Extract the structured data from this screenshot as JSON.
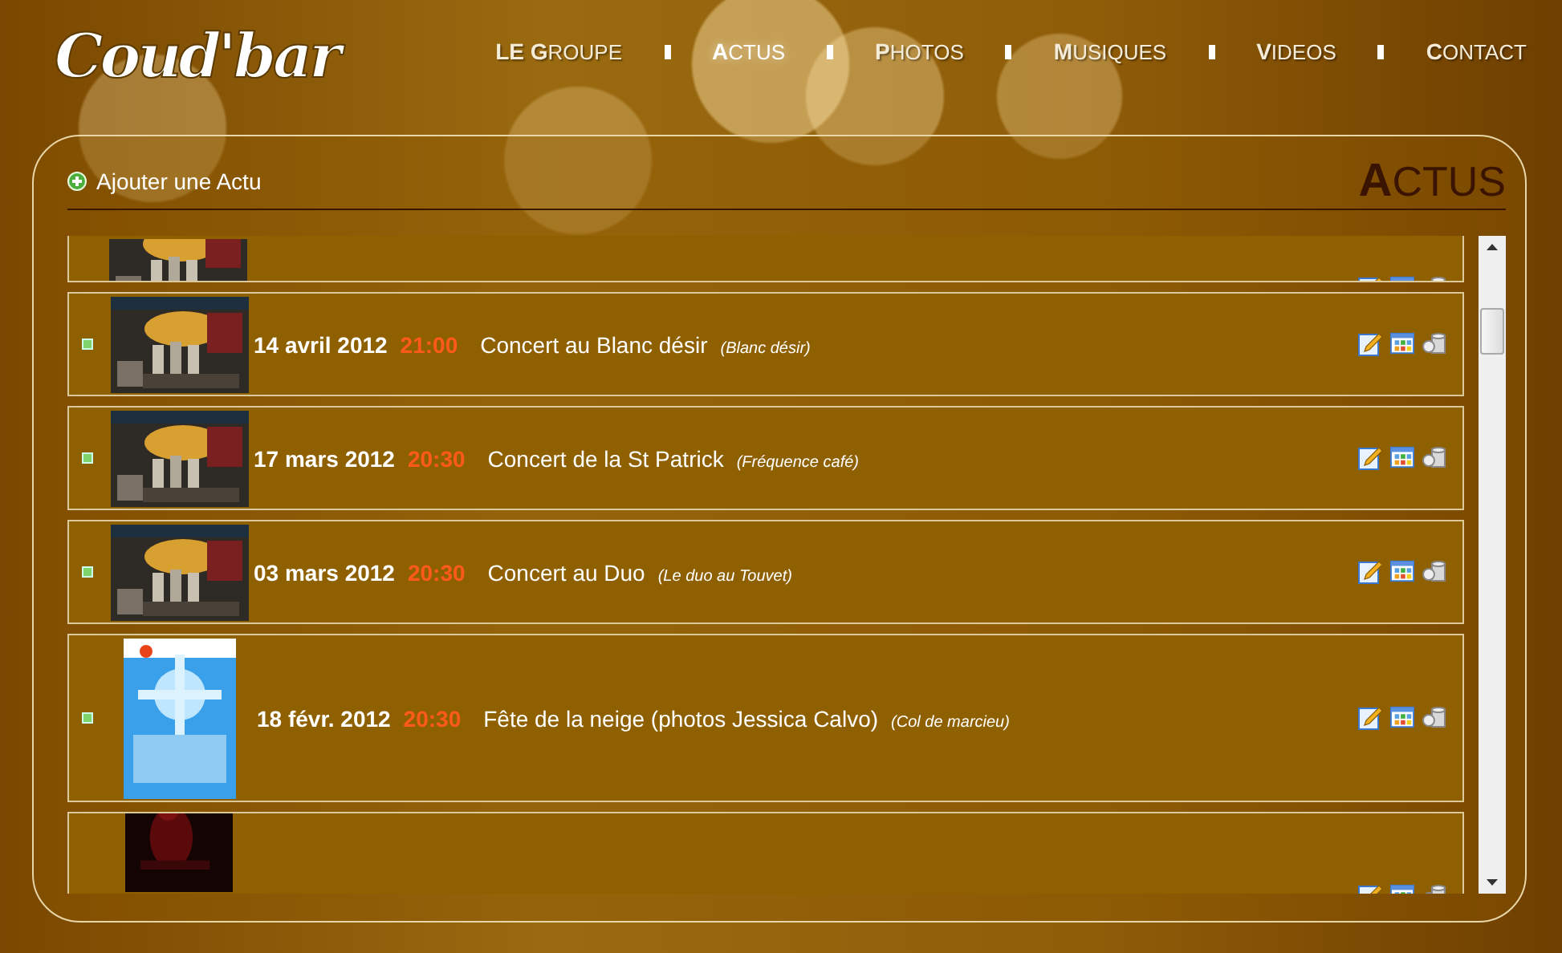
{
  "logo": "Coud'bar",
  "nav": [
    {
      "label": "**LE G**ROUPE",
      "selected": false
    },
    {
      "label": "**A**CTUS",
      "selected": true
    },
    {
      "label": "**P**HOTOS",
      "selected": false
    },
    {
      "label": "**M**USIQUES",
      "selected": false
    },
    {
      "label": "**V**IDEOS",
      "selected": false
    },
    {
      "label": "**C**ONTACT",
      "selected": false
    }
  ],
  "add_link": "Ajouter une Actu",
  "heading": "**A**CTUS",
  "events": [
    {
      "kind": "cut-top"
    },
    {
      "kind": "full",
      "date": "14 avril 2012",
      "time": "21:00",
      "title": "Concert au Blanc désir",
      "venue": "(Blanc désir)"
    },
    {
      "kind": "full",
      "date": "17 mars 2012",
      "time": "20:30",
      "title": "Concert de la St Patrick",
      "venue": "(Fréquence café)"
    },
    {
      "kind": "full",
      "date": "03 mars 2012",
      "time": "20:30",
      "title": "Concert au Duo",
      "venue": "(Le duo au Touvet)"
    },
    {
      "kind": "tall",
      "date": "18 févr. 2012",
      "time": "20:30",
      "title": "Fête de la neige (photos Jessica Calvo)",
      "venue": "(Col de marcieu)"
    },
    {
      "kind": "cut-bottom"
    }
  ]
}
